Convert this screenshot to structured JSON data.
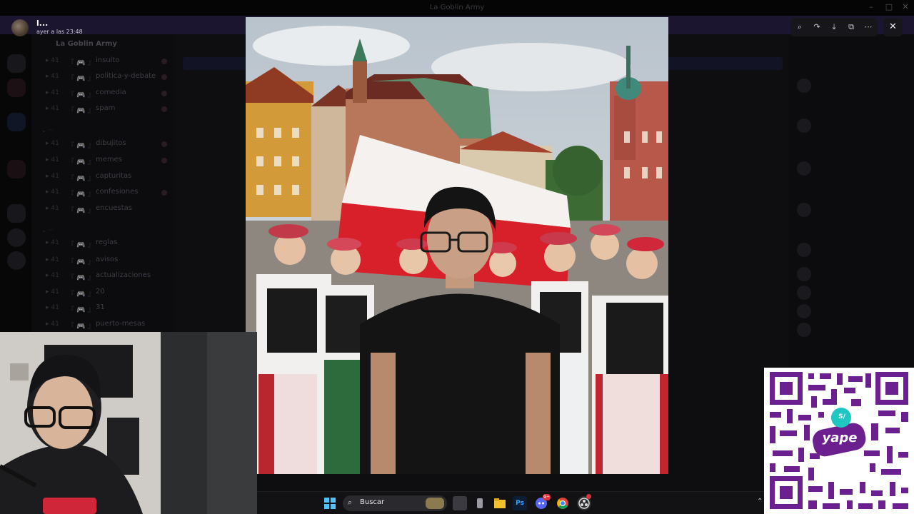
{
  "window": {
    "title": "La Goblin Army"
  },
  "viewer": {
    "uploader_name": "l...",
    "timestamp": "ayer a las 23:48",
    "toolbar": [
      "zoom-icon",
      "forward-icon",
      "download-icon",
      "open-external-icon",
      "more-icon"
    ],
    "close_icon": "close-icon"
  },
  "background_channels": {
    "server_name": "La Goblin Army",
    "items": [
      {
        "name": "insulto"
      },
      {
        "name": "politica-y-debate"
      },
      {
        "name": "comedia"
      },
      {
        "name": "spam"
      },
      {
        "name": "dibujitos"
      },
      {
        "name": "memes"
      },
      {
        "name": "capturitas"
      },
      {
        "name": "confesiones"
      },
      {
        "name": "encuestas"
      },
      {
        "name": "reglas"
      },
      {
        "name": "avisos"
      },
      {
        "name": "actualizaciones"
      },
      {
        "name": "20"
      },
      {
        "name": "31"
      },
      {
        "name": "puerto-mesas"
      }
    ]
  },
  "taskbar": {
    "search_placeholder": "Buscar",
    "discord_badge": "9+",
    "apps": [
      "windows-start-icon",
      "search-icon",
      "task-view-icon",
      "file-explorer-icon",
      "photoshop-icon",
      "discord-icon",
      "chrome-icon",
      "obs-icon"
    ]
  },
  "qr": {
    "brand": "yape",
    "currency": "S/"
  },
  "colors": {
    "qr_purple": "#6c1f8f",
    "accent_red": "#d8202b",
    "flag_white": "#f4f1ee"
  }
}
